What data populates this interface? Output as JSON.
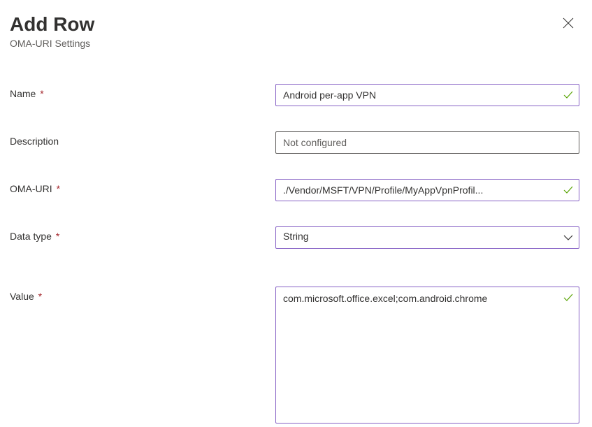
{
  "header": {
    "title": "Add Row",
    "subtitle": "OMA-URI Settings"
  },
  "form": {
    "name": {
      "label": "Name",
      "value": "Android per-app VPN",
      "required": true,
      "validated": true
    },
    "description": {
      "label": "Description",
      "placeholder": "Not configured",
      "value": "",
      "required": false,
      "validated": false
    },
    "oma_uri": {
      "label": "OMA-URI",
      "value": "./Vendor/MSFT/VPN/Profile/MyAppVpnProfil...",
      "required": true,
      "validated": true
    },
    "data_type": {
      "label": "Data type",
      "value": "String",
      "required": true
    },
    "value": {
      "label": "Value",
      "value": "com.microsoft.office.excel;com.android.chrome",
      "required": true,
      "validated": true
    }
  },
  "required_marker": "*"
}
